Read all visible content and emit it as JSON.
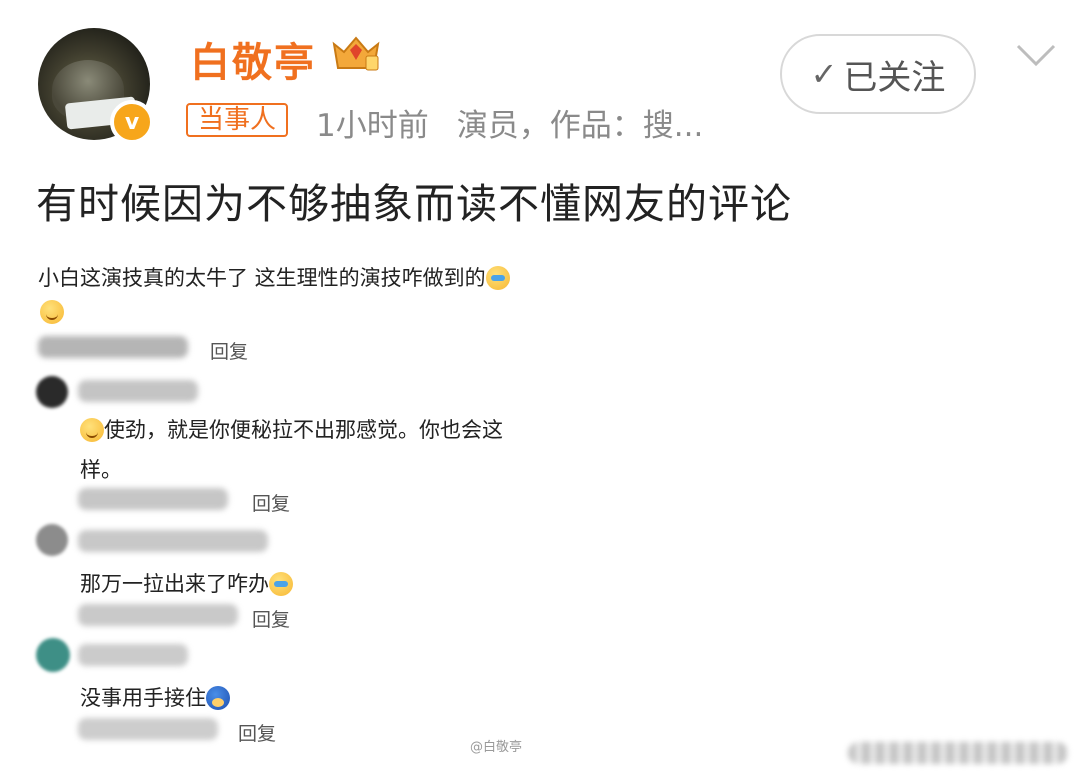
{
  "header": {
    "username": "白敬亭",
    "tag": "当事人",
    "time": "1小时前",
    "bio": "演员，作品：搜...",
    "follow_label": "已关注"
  },
  "post": {
    "text": "有时候因为不够抽象而读不懂网友的评论"
  },
  "comments": {
    "top": {
      "text": "小白这演技真的太牛了 这生理性的演技咋做到的"
    },
    "reply1": {
      "text_line1": "使劲，就是你便秘拉不出那感觉。你也会这",
      "text_line2": "样。"
    },
    "reply2": {
      "text": "那万一拉出来了咋办"
    },
    "reply3": {
      "text": "没事用手接住"
    },
    "reply_label": "回复"
  },
  "watermark": "@白敬亭",
  "colors": {
    "accent": "#f0701f",
    "verified": "#f7a61b"
  }
}
